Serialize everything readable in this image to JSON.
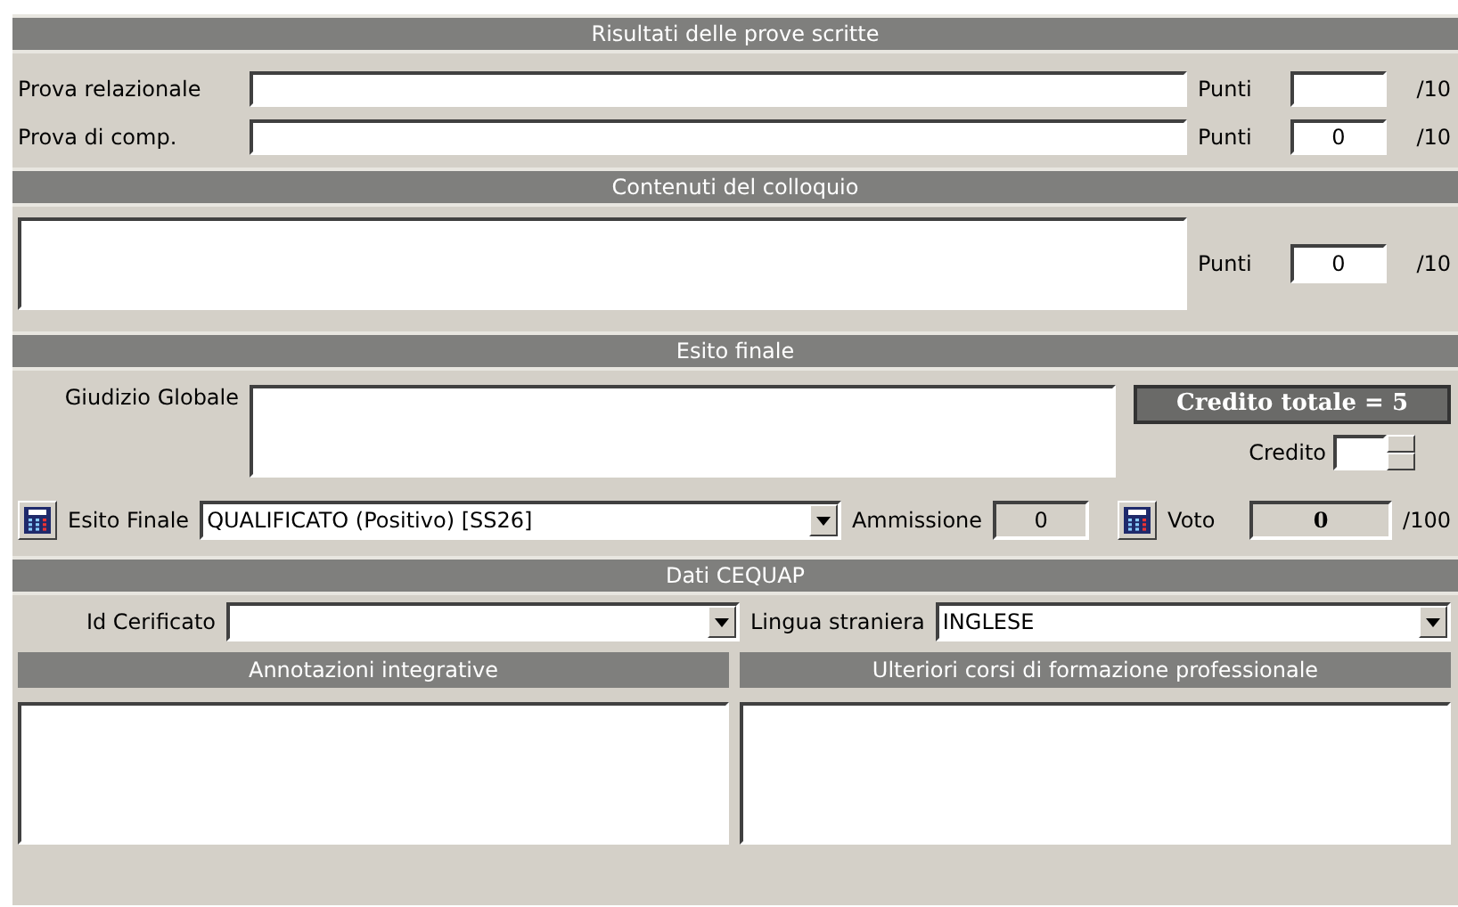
{
  "written_tests": {
    "title": "Risultati delle prove scritte",
    "rows": [
      {
        "label": "Prova relazionale",
        "points_label": "Punti",
        "points_max": "/10"
      },
      {
        "label": "Prova di comp.",
        "points_label": "Punti",
        "points_value": "0",
        "points_max": "/10"
      }
    ]
  },
  "interview": {
    "title": "Contenuti del colloquio",
    "points_label": "Punti",
    "points_value": "0",
    "points_max": "/10"
  },
  "final": {
    "title": "Esito finale",
    "judgement_label": "Giudizio Globale",
    "credit_total": "Credito totale = 5",
    "credit_label": "Credito",
    "outcome_label": "Esito Finale",
    "outcome_value": "QUALIFICATO (Positivo) [SS26]",
    "admission_label": "Ammissione",
    "admission_value": "0",
    "admission_disabled": true,
    "grade_label": "Voto",
    "grade_value": "0",
    "grade_disabled": true,
    "grade_max": "/100"
  },
  "cequap": {
    "title": "Dati CEQUAP",
    "certificate_label": "Id Cerificato",
    "language_label": "Lingua straniera",
    "language_value": "INGLESE",
    "panels": [
      {
        "title": "Annotazioni integrative"
      },
      {
        "title": "Ulteriori corsi di formazione professionale"
      }
    ]
  }
}
